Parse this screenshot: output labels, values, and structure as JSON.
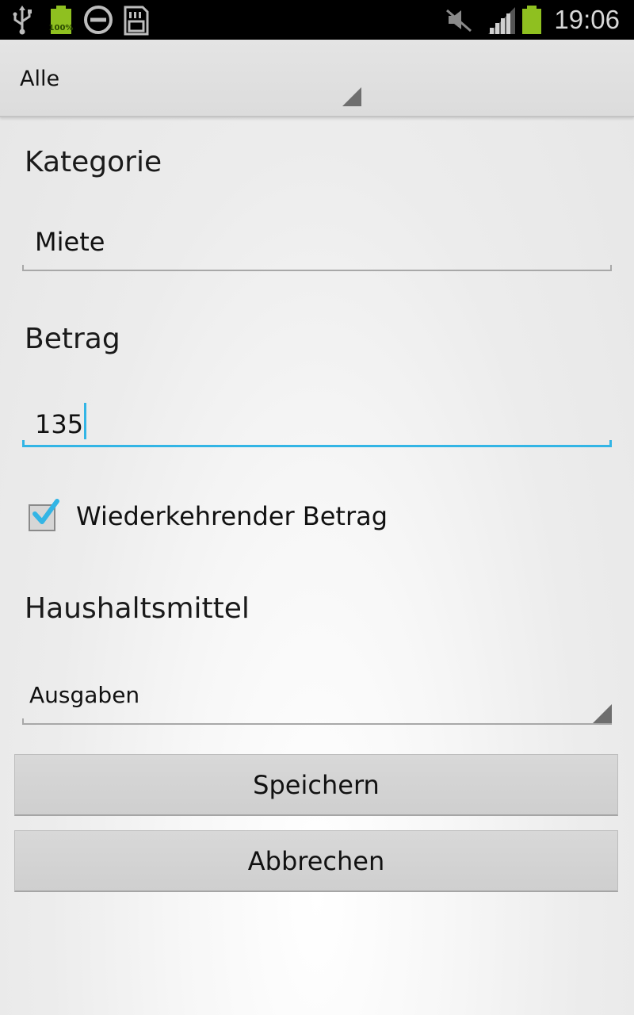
{
  "status_bar": {
    "time": "19:06",
    "battery_left_label": "100%",
    "icons": [
      "usb-icon",
      "battery-icon",
      "do-not-disturb-icon",
      "sd-card-icon",
      "mute-icon",
      "signal-icon",
      "battery-status-icon"
    ],
    "colors": {
      "battery": "#8fc020",
      "background": "#000000"
    }
  },
  "action_bar": {
    "filter_spinner_value": "Alle"
  },
  "form": {
    "category_label": "Kategorie",
    "category_value": "Miete",
    "amount_label": "Betrag",
    "amount_value": "135",
    "recurring_checkbox_label": "Wiederkehrender Betrag",
    "recurring_checked": true,
    "budget_label": "Haushaltsmittel",
    "budget_value": "Ausgaben"
  },
  "buttons": {
    "save_label": "Speichern",
    "cancel_label": "Abbrechen"
  },
  "colors": {
    "accent": "#33b5e5"
  }
}
